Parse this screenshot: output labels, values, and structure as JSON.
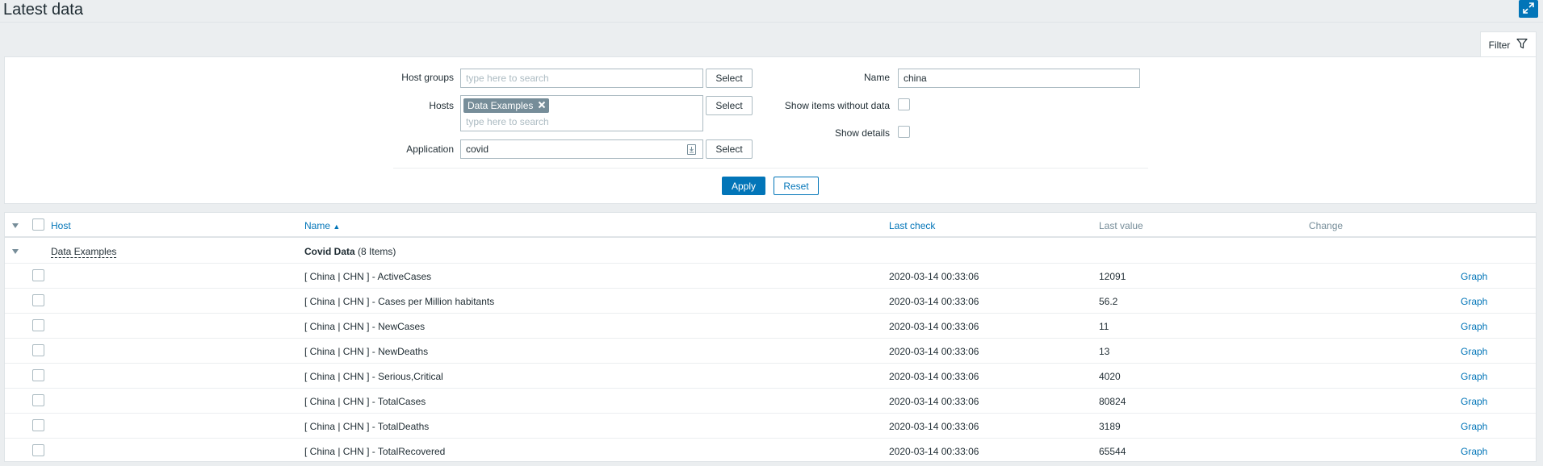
{
  "page": {
    "title": "Latest data"
  },
  "filter": {
    "tab_label": "Filter",
    "host_groups": {
      "label": "Host groups",
      "placeholder": "type here to search",
      "select_label": "Select"
    },
    "hosts": {
      "label": "Hosts",
      "chip": "Data Examples",
      "placeholder": "type here to search",
      "select_label": "Select"
    },
    "application": {
      "label": "Application",
      "value": "covid",
      "select_label": "Select"
    },
    "name": {
      "label": "Name",
      "value": "china"
    },
    "show_without_data": {
      "label": "Show items without data",
      "checked": false
    },
    "show_details": {
      "label": "Show details",
      "checked": false
    },
    "apply_label": "Apply",
    "reset_label": "Reset"
  },
  "table": {
    "columns": {
      "host": "Host",
      "name": "Name",
      "name_sort": "▲",
      "last_check": "Last check",
      "last_value": "Last value",
      "change": "Change"
    },
    "group": {
      "host": "Data Examples",
      "app_name": "Covid Data",
      "app_count": "(8 Items)"
    },
    "rows": [
      {
        "name": "[ China | CHN ] - ActiveCases",
        "last_check": "2020-03-14 00:33:06",
        "last_value": "12091",
        "link": "Graph"
      },
      {
        "name": "[ China | CHN ] - Cases per Million habitants",
        "last_check": "2020-03-14 00:33:06",
        "last_value": "56.2",
        "link": "Graph"
      },
      {
        "name": "[ China | CHN ] - NewCases",
        "last_check": "2020-03-14 00:33:06",
        "last_value": "11",
        "link": "Graph"
      },
      {
        "name": "[ China | CHN ] - NewDeaths",
        "last_check": "2020-03-14 00:33:06",
        "last_value": "13",
        "link": "Graph"
      },
      {
        "name": "[ China | CHN ] - Serious,Critical",
        "last_check": "2020-03-14 00:33:06",
        "last_value": "4020",
        "link": "Graph"
      },
      {
        "name": "[ China | CHN ] - TotalCases",
        "last_check": "2020-03-14 00:33:06",
        "last_value": "80824",
        "link": "Graph"
      },
      {
        "name": "[ China | CHN ] - TotalDeaths",
        "last_check": "2020-03-14 00:33:06",
        "last_value": "3189",
        "link": "Graph"
      },
      {
        "name": "[ China | CHN ] - TotalRecovered",
        "last_check": "2020-03-14 00:33:06",
        "last_value": "65544",
        "link": "Graph"
      }
    ]
  },
  "colors": {
    "accent": "#0275b8",
    "chip": "#768d99",
    "background": "#ebeef0"
  }
}
